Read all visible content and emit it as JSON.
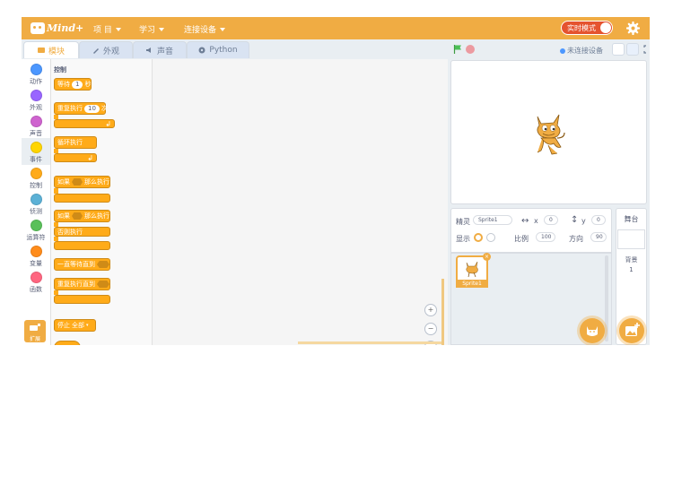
{
  "app": {
    "logo_text": "Mind+"
  },
  "menu": [
    {
      "label": "项 目"
    },
    {
      "label": "学习"
    },
    {
      "label": "连接设备"
    }
  ],
  "realtime_toggle": {
    "label": "实时模式"
  },
  "tabs": [
    {
      "label": "模块",
      "icon": "blocks-icon",
      "active": true
    },
    {
      "label": "外观",
      "icon": "brush-icon"
    },
    {
      "label": "声音",
      "icon": "speaker-icon"
    },
    {
      "label": "Python",
      "icon": "python-icon"
    }
  ],
  "stage_header": {
    "connection_status": "未连接设备"
  },
  "categories": [
    {
      "label": "动作",
      "color": "#4c97ff"
    },
    {
      "label": "外观",
      "color": "#9966ff"
    },
    {
      "label": "声音",
      "color": "#cf63cf"
    },
    {
      "label": "事件",
      "color": "#ffd500",
      "active": true
    },
    {
      "label": "控制",
      "color": "#ffab19"
    },
    {
      "label": "侦测",
      "color": "#5cb1d6"
    },
    {
      "label": "运算符",
      "color": "#59c059"
    },
    {
      "label": "变量",
      "color": "#ff8c1a"
    },
    {
      "label": "函数",
      "color": "#ff6680"
    }
  ],
  "extensions": {
    "label": "扩展"
  },
  "palette": {
    "title": "控制",
    "wait": {
      "text": "等待",
      "value": "1",
      "unit": "秒"
    },
    "repeat": {
      "text": "重复执行",
      "value": "10",
      "unit": "次"
    },
    "forever": {
      "text": "循环执行"
    },
    "if_then": {
      "text": "如果",
      "then": "那么执行"
    },
    "if_else": {
      "text": "如果",
      "then": "那么执行",
      "else": "否则执行"
    },
    "wait_until": {
      "text": "一直等待直到"
    },
    "repeat_until": {
      "text": "重复执行直到"
    },
    "stop": {
      "text": "停止",
      "option": "全部"
    }
  },
  "sprite_info": {
    "sprite_label": "精灵",
    "sprite_name": "Sprite1",
    "x_label": "x",
    "x_value": "0",
    "y_label": "y",
    "y_value": "0",
    "show_label": "显示",
    "size_label": "比例",
    "size_value": "100",
    "direction_label": "方向",
    "direction_value": "90"
  },
  "sprites": [
    {
      "name": "Sprite1"
    }
  ],
  "backdrop": {
    "title": "舞台",
    "label": "背景",
    "count": "1"
  },
  "colors": {
    "accent": "#f0ac43",
    "block_control": "#ffab19",
    "stop": "#ec9aa0",
    "flag": "#4cbf56"
  }
}
